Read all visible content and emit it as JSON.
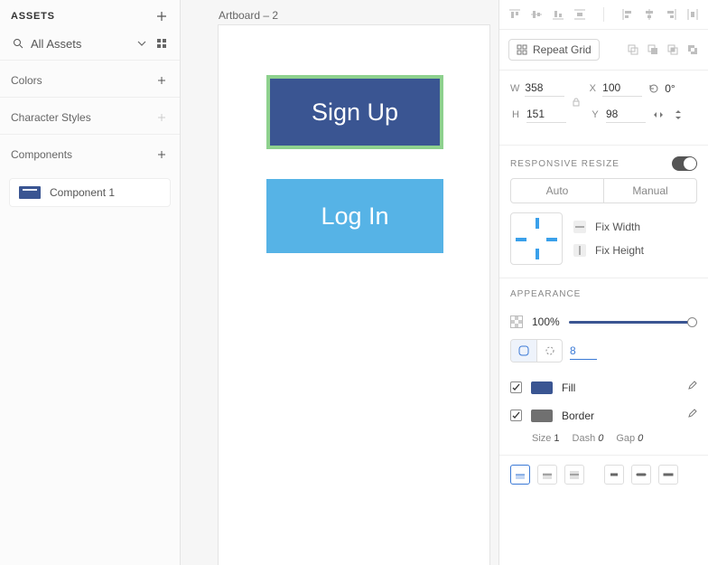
{
  "left": {
    "title": "ASSETS",
    "search_value": "All Assets",
    "sections": {
      "colors": "Colors",
      "charstyles": "Character Styles",
      "components": "Components"
    },
    "component_item": "Component 1"
  },
  "canvas": {
    "artboard_label": "Artboard – 2",
    "signup_label": "Sign Up",
    "login_label": "Log In"
  },
  "inspector": {
    "repeat_grid": "Repeat Grid",
    "transform": {
      "w_label": "W",
      "w": "358",
      "x_label": "X",
      "x": "100",
      "rot": "0°",
      "h_label": "H",
      "h": "151",
      "y_label": "Y",
      "y": "98"
    },
    "responsive": {
      "title": "RESPONSIVE RESIZE",
      "auto": "Auto",
      "manual": "Manual",
      "fix_width": "Fix Width",
      "fix_height": "Fix Height"
    },
    "appearance": {
      "title": "APPEARANCE",
      "opacity": "100%",
      "corner_radius": "8",
      "fill_label": "Fill",
      "border_label": "Border",
      "size_label": "Size",
      "size_val": "1",
      "dash_label": "Dash",
      "dash_val": "0",
      "gap_label": "Gap",
      "gap_val": "0"
    }
  }
}
